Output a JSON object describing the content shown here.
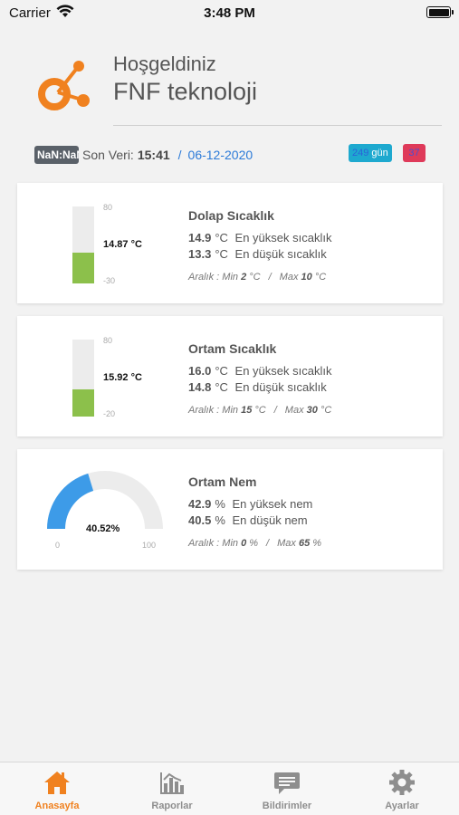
{
  "status_bar": {
    "carrier": "Carrier",
    "time": "3:48 PM"
  },
  "header": {
    "welcome": "Hoşgeldiniz",
    "company": "FNF teknoloji"
  },
  "info": {
    "badge": "NaN:NaN",
    "last_data_label": "Son Veri:",
    "last_data_time": "15:41",
    "separator": "/",
    "last_data_date": "06-12-2020",
    "days_value": "249",
    "days_unit": "gün",
    "alert_count": "37"
  },
  "cards": [
    {
      "title": "Dolap Sıcaklık",
      "reading": "14.87 °C",
      "scale_max": "80",
      "scale_min": "-30",
      "level": 0.405,
      "high_value": "14.9",
      "high_unit": "°C",
      "high_label": "En yüksek sıcaklık",
      "low_value": "13.3",
      "low_unit": "°C",
      "low_label": "En düşük sıcaklık",
      "range_prefix": "Aralık : Min",
      "range_min": "2",
      "range_min_unit": "°C",
      "range_sep": "/",
      "range_max_prefix": "Max",
      "range_max": "10",
      "range_max_unit": "°C"
    },
    {
      "title": "Ortam Sıcaklık",
      "reading": "15.92 °C",
      "scale_max": "80",
      "scale_min": "-20",
      "level": 0.359,
      "high_value": "16.0",
      "high_unit": "°C",
      "high_label": "En yüksek sıcaklık",
      "low_value": "14.8",
      "low_unit": "°C",
      "low_label": "En düşük sıcaklık",
      "range_prefix": "Aralık : Min",
      "range_min": "15",
      "range_min_unit": "°C",
      "range_sep": "/",
      "range_max_prefix": "Max",
      "range_max": "30",
      "range_max_unit": "°C"
    },
    {
      "title": "Ortam Nem",
      "reading": "40.52%",
      "scale_min": "0",
      "scale_max": "100",
      "level": 0.4052,
      "high_value": "42.9",
      "high_unit": "%",
      "high_label": "En yüksek nem",
      "low_value": "40.5",
      "low_unit": "%",
      "low_label": "En düşük nem",
      "range_prefix": "Aralık : Min",
      "range_min": "0",
      "range_min_unit": "%",
      "range_sep": "/",
      "range_max_prefix": "Max",
      "range_max": "65",
      "range_max_unit": "%"
    }
  ],
  "tabs": [
    {
      "label": "Anasayfa",
      "icon": "home-icon",
      "active": true
    },
    {
      "label": "Raporlar",
      "icon": "chart-icon",
      "active": false
    },
    {
      "label": "Bildirimler",
      "icon": "message-icon",
      "active": false
    },
    {
      "label": "Ayarlar",
      "icon": "gear-icon",
      "active": false
    }
  ],
  "colors": {
    "accent": "#f0811f",
    "thermo_fill": "#8cc04b",
    "gauge_fill": "#3d9be8",
    "link": "#2b7ad8",
    "badge_cyan": "#1ea9cf",
    "badge_red": "#df3a5a"
  }
}
